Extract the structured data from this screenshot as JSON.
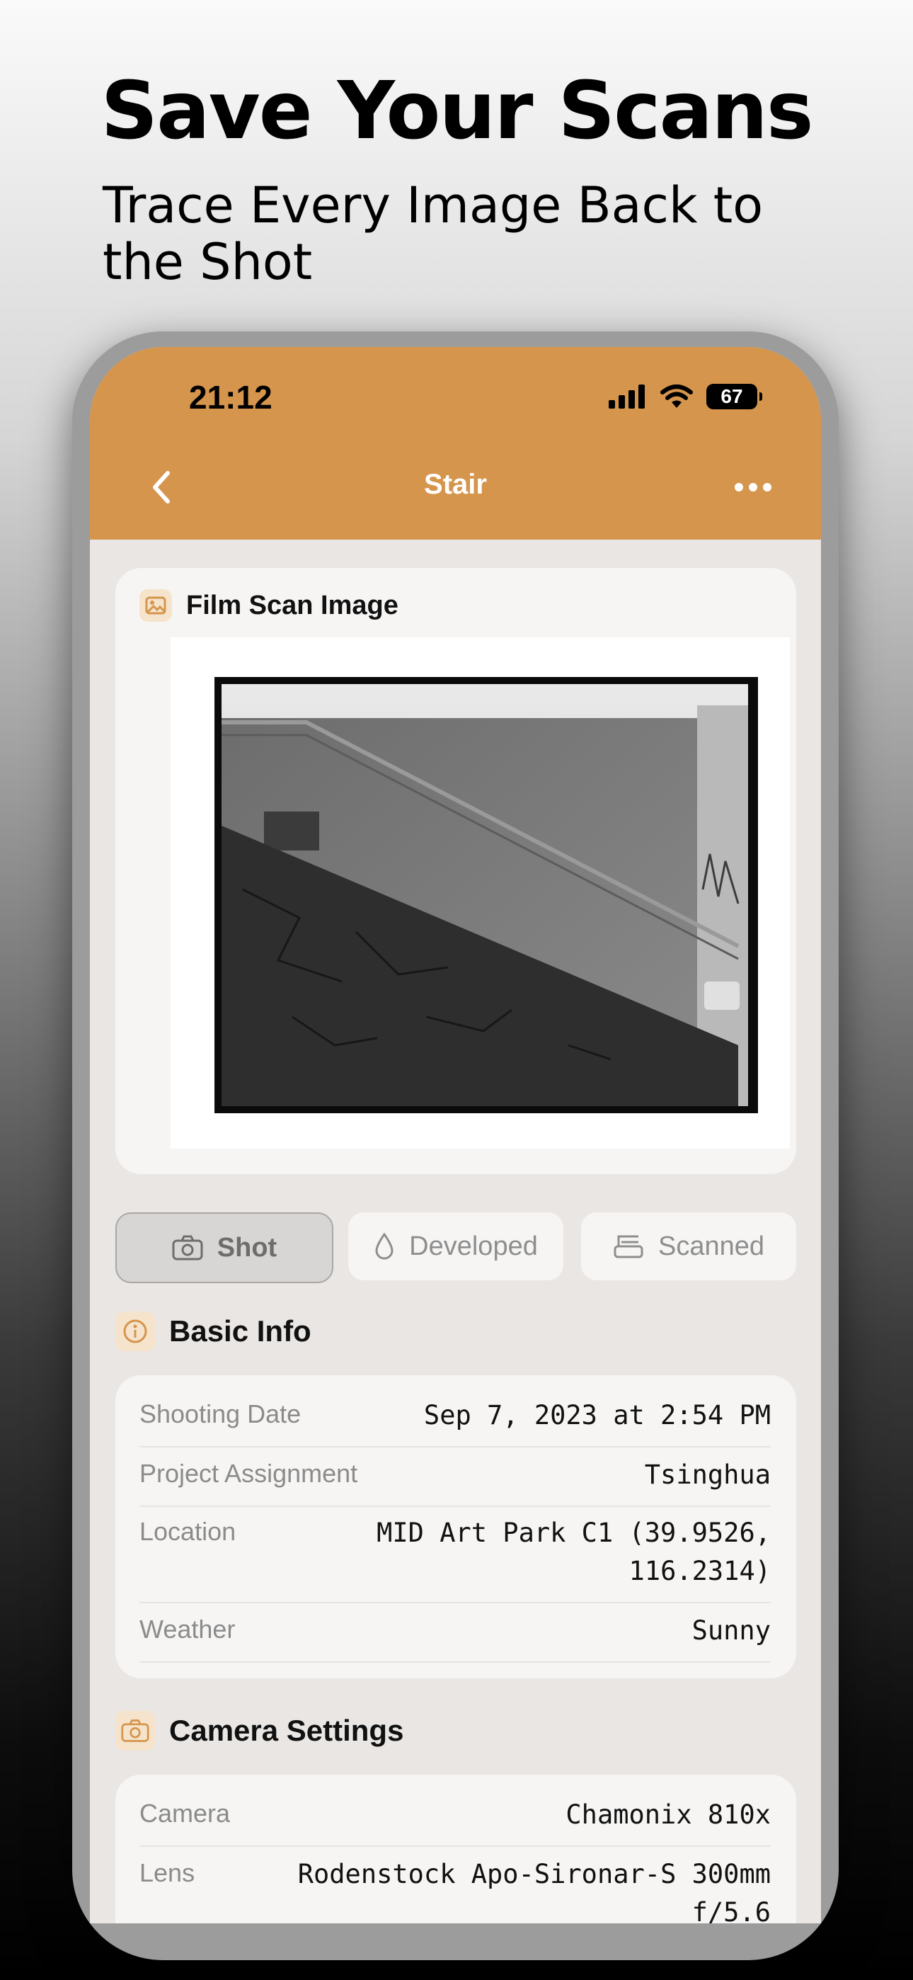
{
  "promo": {
    "headline": "Save Your Scans",
    "subheadline": "Trace Every Image Back to the Shot"
  },
  "status_bar": {
    "time": "21:12",
    "battery": "67"
  },
  "nav": {
    "title": "Stair"
  },
  "film_scan": {
    "title": "Film Scan Image"
  },
  "tabs": {
    "shot": "Shot",
    "developed": "Developed",
    "scanned": "Scanned",
    "selected": "Shot"
  },
  "basic_info": {
    "title": "Basic Info",
    "rows": [
      {
        "label": "Shooting Date",
        "value": "Sep 7, 2023 at 2:54 PM"
      },
      {
        "label": "Project Assignment",
        "value": "Tsinghua"
      },
      {
        "label": "Location",
        "value_line1": "MID Art Park C1 (39.9526,",
        "value_line2": "116.2314)"
      },
      {
        "label": "Weather",
        "value": "Sunny"
      }
    ]
  },
  "camera_settings": {
    "title": "Camera Settings",
    "rows": [
      {
        "label": "Camera",
        "value": "Chamonix 810x"
      },
      {
        "label": "Lens",
        "value_line1": "Rodenstock Apo-Sironar-S 300mm",
        "value_line2": "f/5.6"
      }
    ]
  },
  "colors": {
    "accent": "#d5954c",
    "icon_tint": "#d5954c"
  }
}
